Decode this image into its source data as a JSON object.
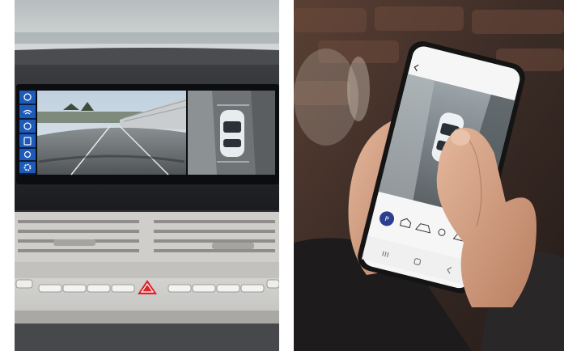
{
  "left_photo": {
    "sidebar_icons": [
      "camera-front-icon",
      "wifi-icon",
      "camera-rear-icon",
      "camera-side-icon",
      "display-icon",
      "gear-icon"
    ],
    "screen_caption": "",
    "console_labels": [
      "",
      "",
      "",
      "",
      "",
      "",
      "",
      ""
    ]
  },
  "right_photo": {
    "phone_status": "",
    "phone_title": "",
    "bottom_nav_icons": [
      "parking-icon",
      "home-icon",
      "car-icon",
      "alert-icon",
      "car-icon"
    ],
    "softkeys": [
      "menu-softkey-icon",
      "home-softkey-icon",
      "back-softkey-icon"
    ]
  },
  "colors": {
    "screen_accent": "#1e5bb8",
    "hazard": "#d9252b",
    "app_accent": "#2c3e8f"
  }
}
